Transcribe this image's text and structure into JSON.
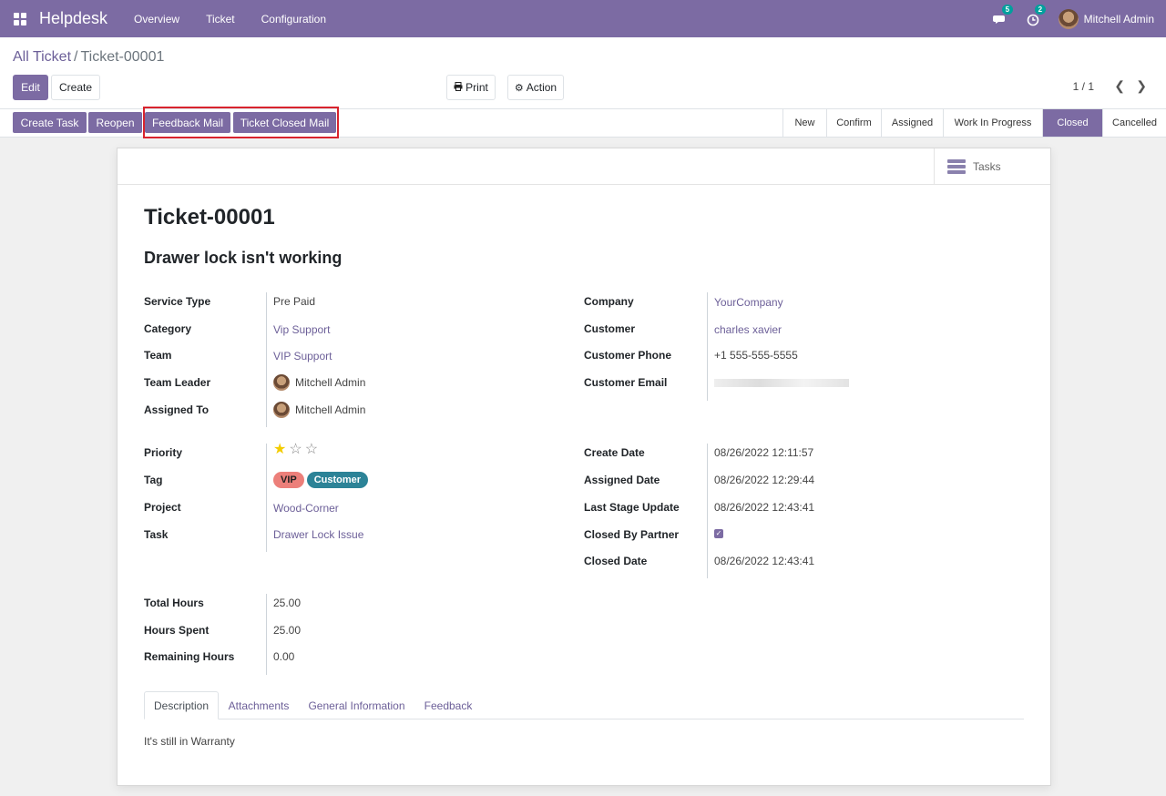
{
  "navbar": {
    "app_name": "Helpdesk",
    "menu": [
      "Overview",
      "Ticket",
      "Configuration"
    ],
    "messages_count": "5",
    "activities_count": "2",
    "user_name": "Mitchell Admin"
  },
  "breadcrumb": {
    "parent": "All Ticket",
    "separator": "/",
    "current": "Ticket-00001"
  },
  "toolbar": {
    "edit": "Edit",
    "create": "Create",
    "print": "Print",
    "action": "Action",
    "pager": "1 / 1"
  },
  "statusbar": {
    "buttons": [
      "Create Task",
      "Reopen",
      "Feedback Mail",
      "Ticket Closed Mail"
    ],
    "stages": [
      "New",
      "Confirm",
      "Assigned",
      "Work In Progress",
      "Closed",
      "Cancelled"
    ],
    "active_stage": "Closed"
  },
  "smart_button": {
    "label": "Tasks"
  },
  "ticket": {
    "number": "Ticket-00001",
    "subject": "Drawer lock isn't working",
    "service_type_label": "Service Type",
    "service_type": "Pre Paid",
    "category_label": "Category",
    "category": "Vip Support",
    "team_label": "Team",
    "team": "VIP Support",
    "team_leader_label": "Team Leader",
    "team_leader": "Mitchell Admin",
    "assigned_to_label": "Assigned To",
    "assigned_to": "Mitchell Admin",
    "company_label": "Company",
    "company": "YourCompany",
    "customer_label": "Customer",
    "customer": "charles xavier",
    "customer_phone_label": "Customer Phone",
    "customer_phone": "+1 555-555-5555",
    "customer_email_label": "Customer Email",
    "priority_label": "Priority",
    "priority": 1,
    "priority_max": 3,
    "tag_label": "Tag",
    "tags": [
      {
        "name": "VIP",
        "color": "#ec7f7a"
      },
      {
        "name": "Customer",
        "color": "#2c8397"
      }
    ],
    "project_label": "Project",
    "project": "Wood-Corner",
    "task_label": "Task",
    "task": "Drawer Lock Issue",
    "create_date_label": "Create Date",
    "create_date": "08/26/2022 12:11:57",
    "assigned_date_label": "Assigned Date",
    "assigned_date": "08/26/2022 12:29:44",
    "last_stage_update_label": "Last Stage Update",
    "last_stage_update": "08/26/2022 12:43:41",
    "closed_by_partner_label": "Closed By Partner",
    "closed_by_partner": true,
    "closed_date_label": "Closed Date",
    "closed_date": "08/26/2022 12:43:41",
    "total_hours_label": "Total Hours",
    "total_hours": "25.00",
    "hours_spent_label": "Hours Spent",
    "hours_spent": "25.00",
    "remaining_hours_label": "Remaining Hours",
    "remaining_hours": "0.00"
  },
  "tabs": [
    "Description",
    "Attachments",
    "General Information",
    "Feedback"
  ],
  "active_tab": "Description",
  "description": "It's still in Warranty",
  "colors": {
    "brand": "#7c6ba3",
    "link": "#6c5f98",
    "highlight": "#d9232d",
    "star": "#f3cc00"
  }
}
